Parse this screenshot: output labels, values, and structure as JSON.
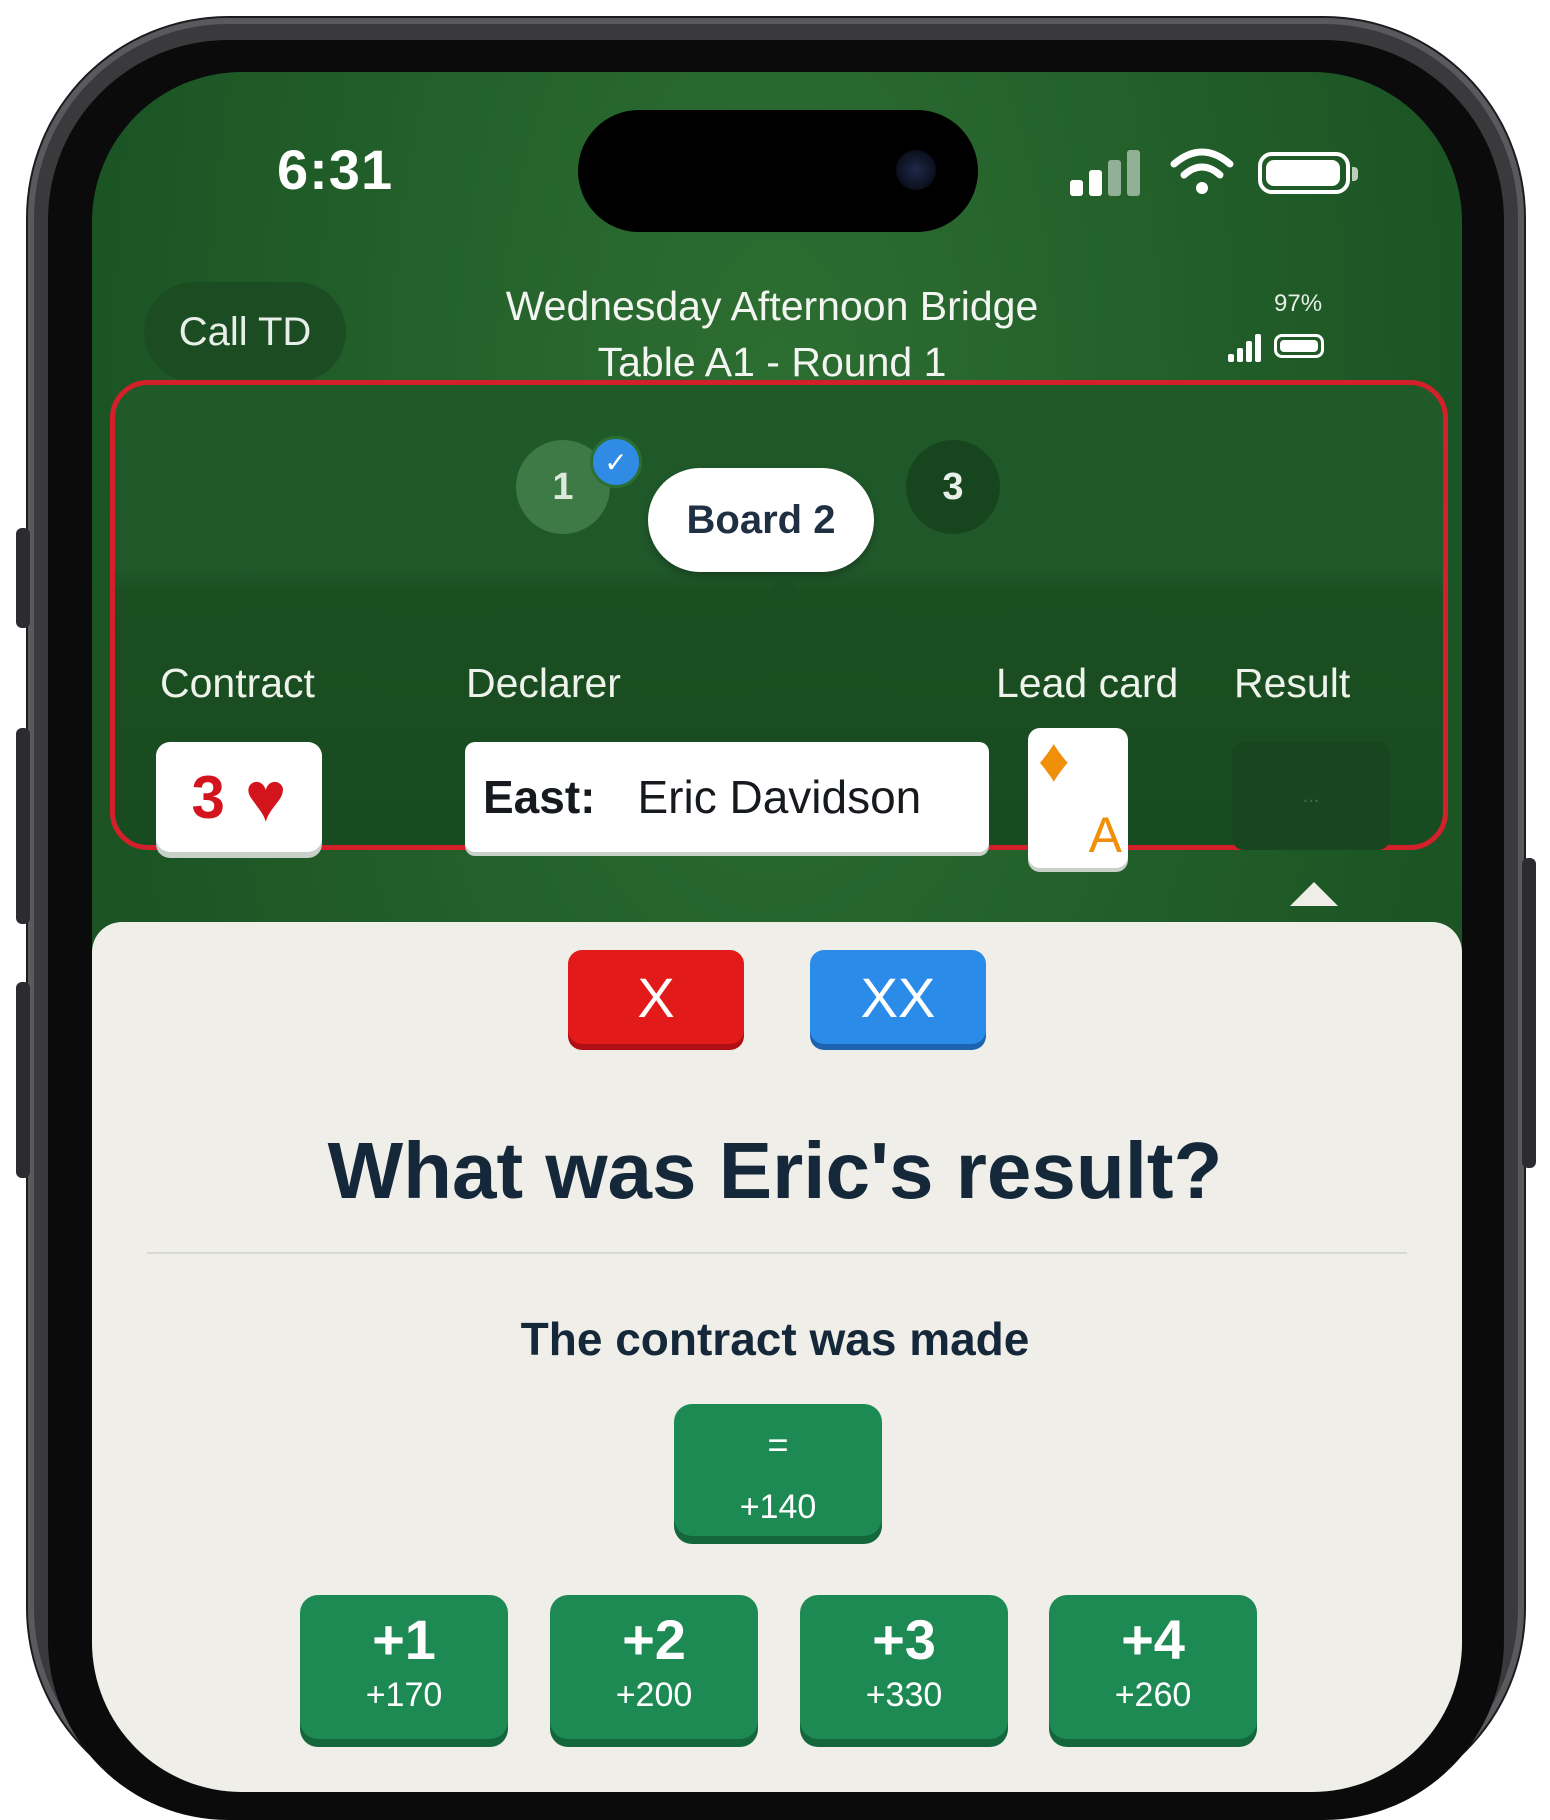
{
  "status_bar": {
    "time": "6:31"
  },
  "header": {
    "call_td_label": "Call TD",
    "event_title": "Wednesday Afternoon Bridge",
    "table_round": "Table A1  -  Round 1",
    "battery_percent": "97%"
  },
  "boards": {
    "items": [
      {
        "label": "1",
        "completed": true
      },
      {
        "label": "Board 2",
        "current": true
      },
      {
        "label": "3",
        "completed": false
      }
    ]
  },
  "board_details": {
    "contract_label": "Contract",
    "declarer_label": "Declarer",
    "lead_card_label": "Lead card",
    "result_label": "Result",
    "contract_level": "3",
    "contract_suit": "♥",
    "declarer_direction": "East:",
    "declarer_name": "Eric Davidson",
    "lead_suit": "♦",
    "lead_rank": "A",
    "result_placeholder": "..."
  },
  "doubles": {
    "double_label": "X",
    "redouble_label": "XX"
  },
  "result_prompt": {
    "question": "What was Eric's result?",
    "made_label": "The contract was made"
  },
  "result_options": {
    "exact": {
      "label": "=",
      "score": "+140"
    },
    "overtricks": [
      {
        "label": "+1",
        "score": "+170"
      },
      {
        "label": "+2",
        "score": "+200"
      },
      {
        "label": "+3",
        "score": "+330"
      },
      {
        "label": "+4",
        "score": "+260"
      }
    ]
  },
  "colors": {
    "felt_green": "#1f5a27",
    "highlight_red": "#d3202a",
    "double_red": "#e21a1a",
    "redouble_blue": "#2b8be8",
    "result_green": "#1e8a53",
    "sheet_bg": "#efeee8"
  }
}
